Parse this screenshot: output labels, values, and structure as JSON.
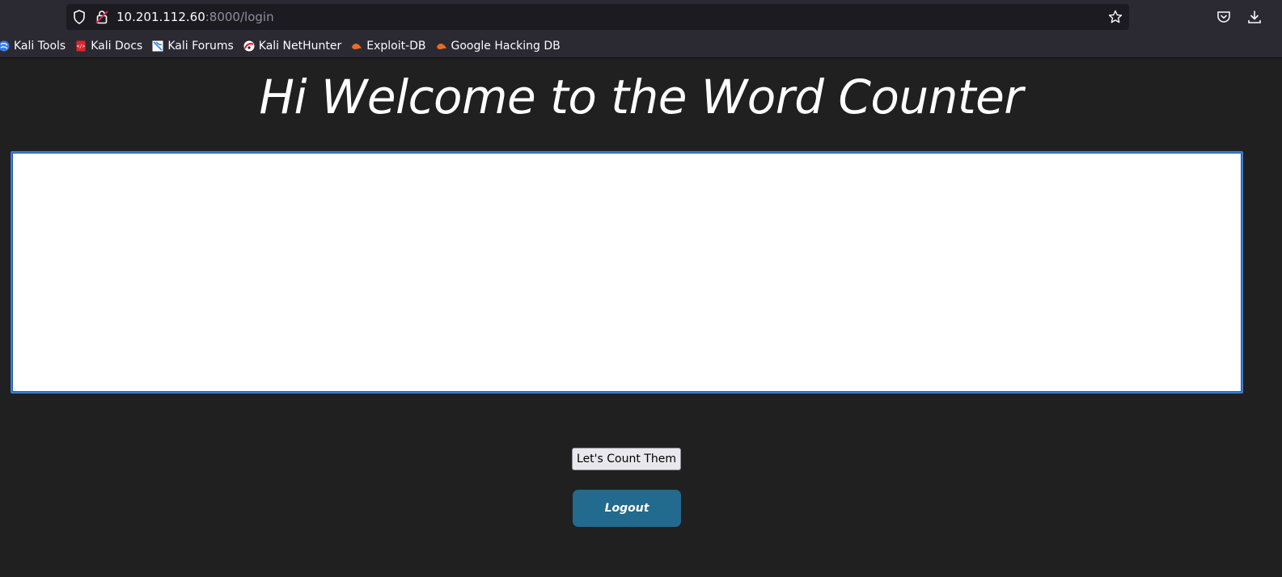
{
  "browser": {
    "url_host": "10.201.112.60",
    "url_path": ":8000/login",
    "bookmarks": [
      {
        "label": "Kali Tools",
        "icon": "kali-tools-icon",
        "color": "#367bf0"
      },
      {
        "label": "Kali Docs",
        "icon": "kali-docs-icon",
        "color": "#e0242a"
      },
      {
        "label": "Kali Forums",
        "icon": "kali-forums-icon",
        "color": "#3b8de0"
      },
      {
        "label": "Kali NetHunter",
        "icon": "kali-nethunter-icon",
        "color": "#e0242a"
      },
      {
        "label": "Exploit-DB",
        "icon": "exploit-db-icon",
        "color": "#ec6b21"
      },
      {
        "label": "Google Hacking DB",
        "icon": "google-hacking-db-icon",
        "color": "#ec6b21"
      }
    ]
  },
  "page": {
    "title": "Hi Welcome to the Word Counter",
    "textarea_value": "",
    "count_button_label": "Let's Count Them",
    "logout_button_label": "Logout"
  },
  "colors": {
    "background": "#202020",
    "logout_button": "#226a8e",
    "textarea_border": "#3b7fd0"
  }
}
